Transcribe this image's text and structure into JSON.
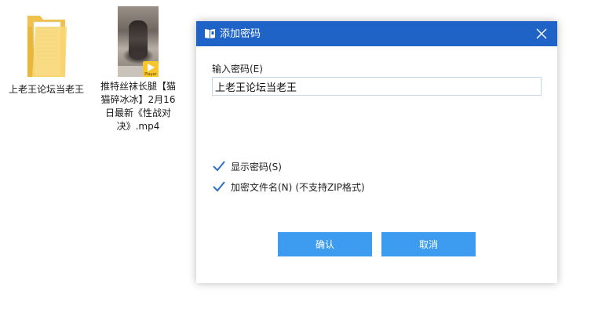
{
  "desktop": {
    "items": [
      {
        "label": "上老王论坛当老王",
        "icon": "folder-icon"
      },
      {
        "label": "推特丝袜长腿【猫猫碎冰冰】2月16日最新《性战对决》.mp4",
        "icon": "video-thumbnail",
        "badge": "Player"
      }
    ]
  },
  "dialog": {
    "title": "添加密码",
    "password_label": "输入密码(E)",
    "password_value": "上老王论坛当老王",
    "show_password": {
      "label": "显示密码(S)",
      "checked": true
    },
    "encrypt_filenames": {
      "label": "加密文件名(N)",
      "note": "(不支持ZIP格式)",
      "checked": true
    },
    "ok_label": "确认",
    "cancel_label": "取消"
  },
  "colors": {
    "titlebar": "#1f63c6",
    "button": "#3d9bf0",
    "checkmark": "#2f6fc4"
  }
}
